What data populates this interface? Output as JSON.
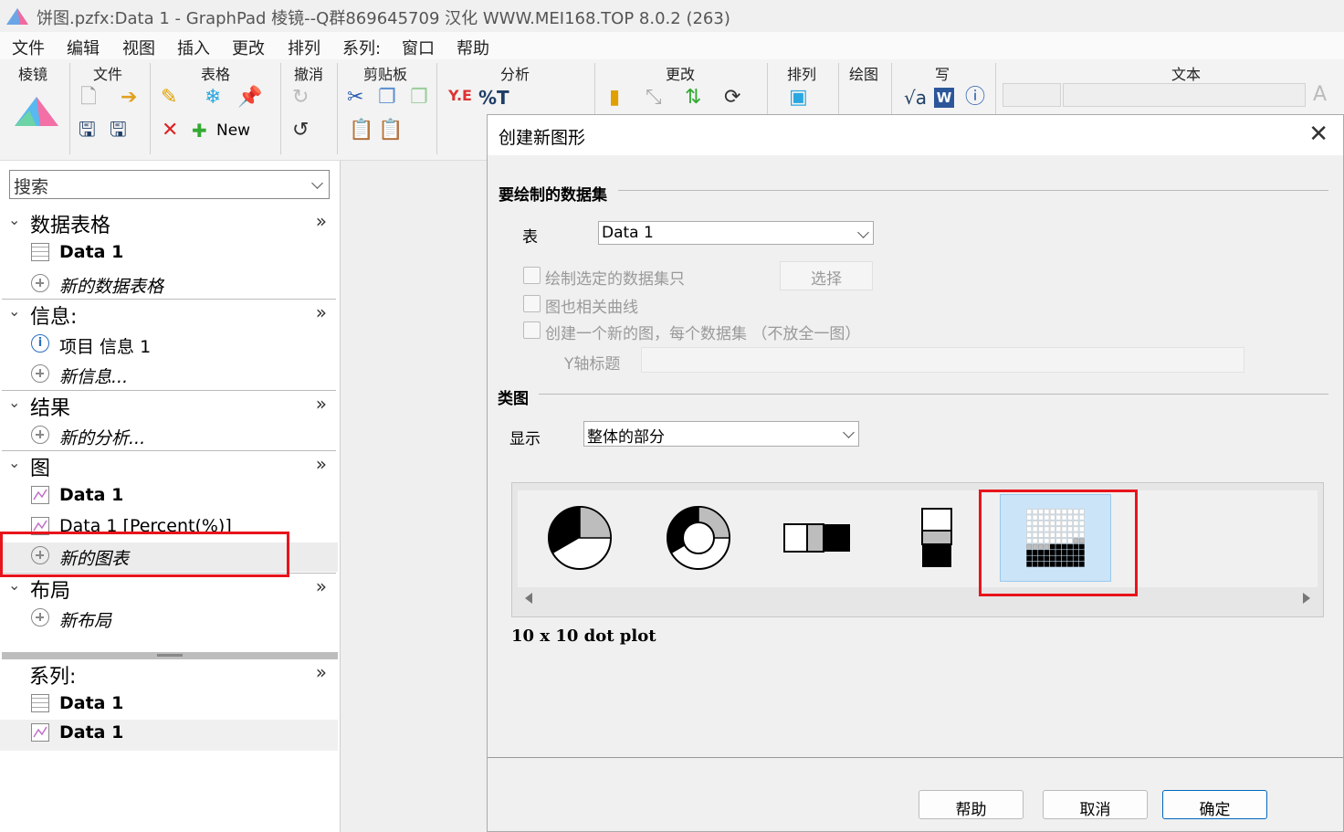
{
  "window": {
    "title": "饼图.pzfx:Data 1 - GraphPad 棱镜--Q群869645709 汉化 WWW.MEI168.TOP 8.0.2 (263)"
  },
  "menu": [
    "文件",
    "编辑",
    "视图",
    "插入",
    "更改",
    "排列",
    "系列:",
    "窗口",
    "帮助"
  ],
  "ribbon": {
    "groups": [
      "棱镜",
      "文件",
      "表格",
      "撤消",
      "剪贴板",
      "分析",
      "更改",
      "排列",
      "绘图",
      "写",
      "文本"
    ],
    "new_label": "New"
  },
  "navigator": {
    "search_placeholder": "搜索",
    "more": "»",
    "sections": {
      "data_tables": {
        "title": "数据表格",
        "items": [
          "Data 1"
        ],
        "new": "新的数据表格"
      },
      "info": {
        "title": "信息:",
        "items": [
          "项目 信息 1"
        ],
        "new": "新信息..."
      },
      "results": {
        "title": "结果",
        "new": "新的分析..."
      },
      "graphs": {
        "title": "图",
        "items": [
          "Data 1",
          "Data 1 [Percent(%)]"
        ],
        "new": "新的图表"
      },
      "layouts": {
        "title": "布局",
        "new": "新布局"
      },
      "family": {
        "title": "系列:",
        "items": [
          "Data 1",
          "Data 1"
        ]
      }
    }
  },
  "dialog": {
    "title": "创建新图形",
    "dataset_section": "要绘制的数据集",
    "table_label": "表",
    "table_value": "Data 1",
    "cb_selected_only": "绘制选定的数据集只",
    "select_button": "选择",
    "cb_related_curves": "图也相关曲线",
    "cb_new_graph_each": "创建一个新的图，每个数据集 （不放全一图）",
    "y_axis_title_label": "Y轴标题",
    "type_section": "类图",
    "show_label": "显示",
    "show_value": "整体的部分",
    "gallery_selected_caption": "10 x 10 dot plot",
    "buttons": {
      "help": "帮助",
      "cancel": "取消",
      "ok": "确定"
    }
  },
  "colors": {
    "highlight": "#e8141c",
    "selected_tile": "#cce4f7",
    "ok_border": "#0067c0"
  }
}
